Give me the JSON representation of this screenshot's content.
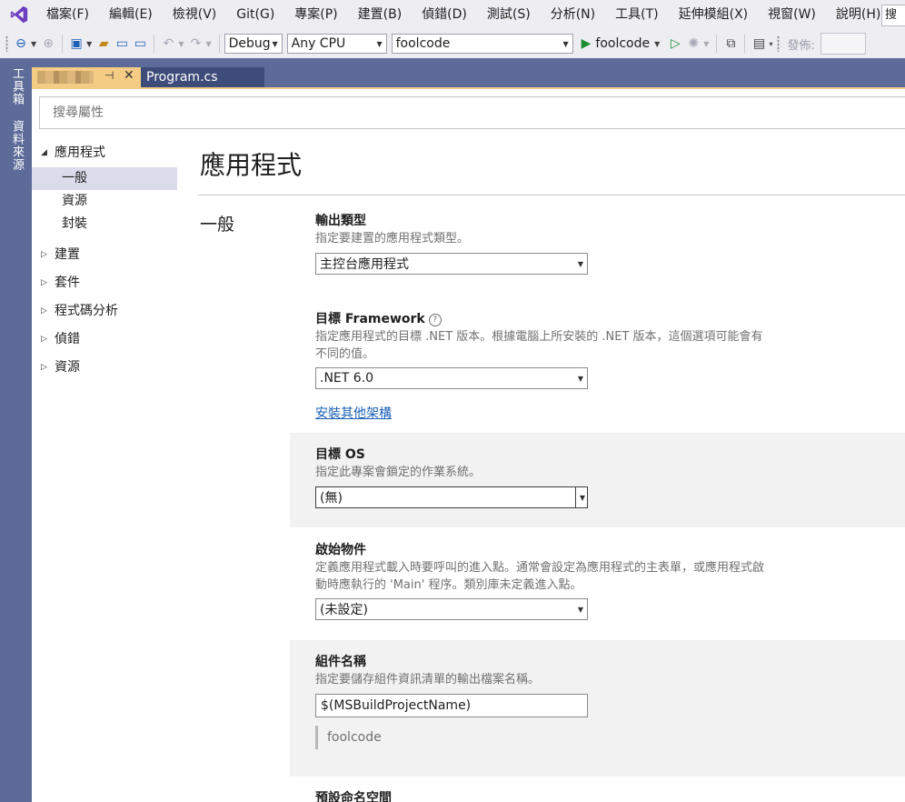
{
  "menu": {
    "items": [
      "檔案(F)",
      "編輯(E)",
      "檢視(V)",
      "Git(G)",
      "專案(P)",
      "建置(B)",
      "偵錯(D)",
      "測試(S)",
      "分析(N)",
      "工具(T)",
      "延伸模組(X)",
      "視窗(W)",
      "說明(H)"
    ],
    "search_text": "搜"
  },
  "toolbar": {
    "configuration": "Debug",
    "platform": "Any CPU",
    "startup_project": "foolcode",
    "run_label": "foolcode",
    "publish_label": "發佈:"
  },
  "side_tabs": {
    "toolbox": "工具箱",
    "data_sources": "資料來源"
  },
  "doc_tabs": {
    "active_file": "Program.cs"
  },
  "search": {
    "placeholder": "搜尋屬性"
  },
  "nav": {
    "application": "應用程式",
    "application_children": [
      "一般",
      "資源",
      "封裝"
    ],
    "collapsed": [
      "建置",
      "套件",
      "程式碼分析",
      "偵錯",
      "資源"
    ]
  },
  "page": {
    "title": "應用程式",
    "section": "一般"
  },
  "properties": {
    "output_type": {
      "title": "輸出類型",
      "desc": "指定要建置的應用程式類型。",
      "value": "主控台應用程式"
    },
    "target_framework": {
      "title": "目標 Framework",
      "info": "?",
      "desc": "指定應用程式的目標 .NET 版本。根據電腦上所安裝的 .NET 版本，這個選項可能會有不同的值。",
      "value": ".NET 6.0",
      "link": "安裝其他架構"
    },
    "target_os": {
      "title": "目標 OS",
      "desc": "指定此專案會鎖定的作業系統。",
      "value": "(無)"
    },
    "startup_object": {
      "title": "啟始物件",
      "desc": "定義應用程式載入時要呼叫的進入點。通常會設定為應用程式的主表單，或應用程式啟動時應執行的 'Main' 程序。類別庫未定義進入點。",
      "value": "(未設定)"
    },
    "assembly_name": {
      "title": "組件名稱",
      "desc": "指定要儲存組件資訊清單的輸出檔案名稱。",
      "value": "$(MSBuildProjectName)",
      "evaluated": "foolcode"
    },
    "default_namespace": {
      "title": "預設命名空間"
    }
  },
  "colors": {
    "accent_tab": "#f5cc84",
    "frame": "#5d6b99",
    "link": "#1a5fb4",
    "run": "#1b8d30"
  }
}
